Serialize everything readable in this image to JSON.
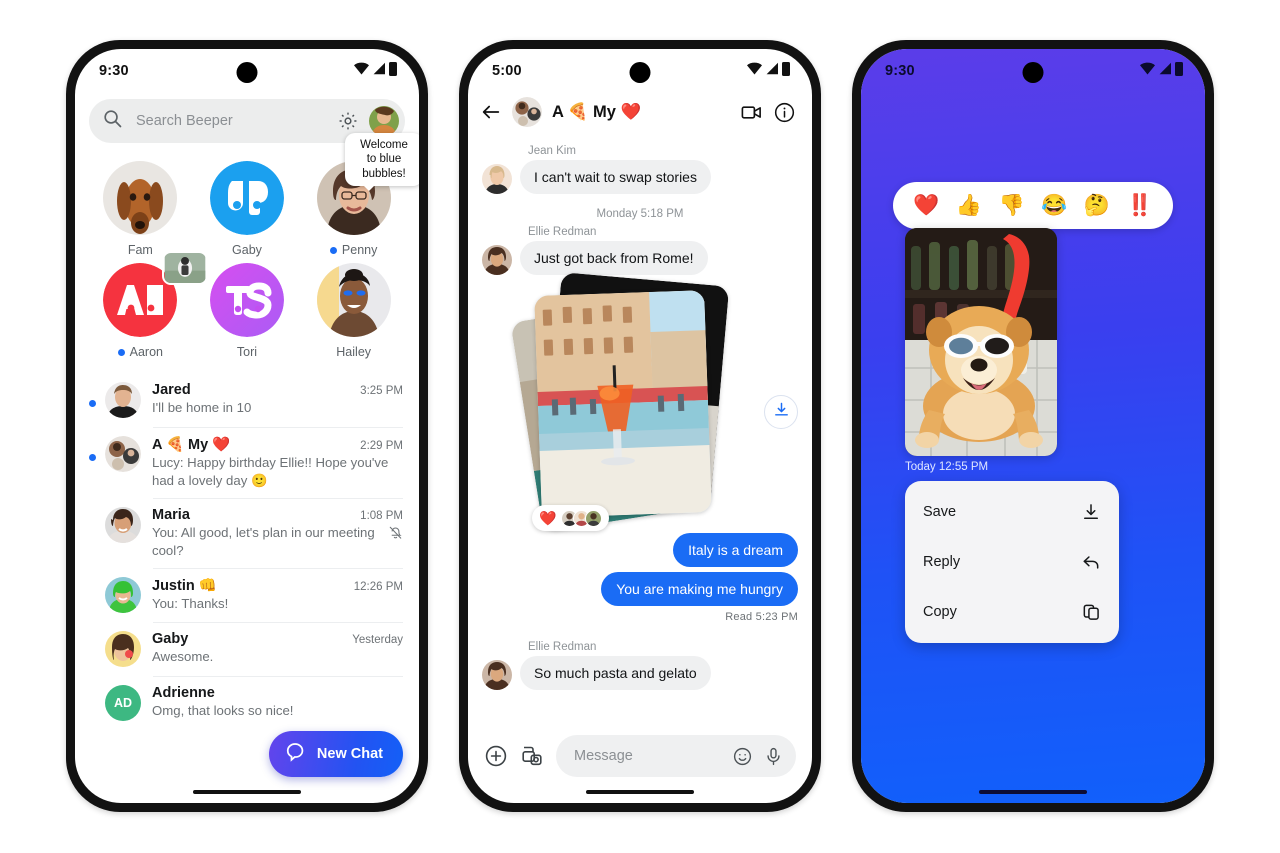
{
  "colors": {
    "accent_blue": "#1a6cf5",
    "bubble_blue": "#1a6cf5",
    "fab_gradient_from": "#6344ec",
    "fab_gradient_to": "#1360f7",
    "p3_bg_from": "#5b3de9",
    "p3_bg_to": "#1160fb",
    "bubble_grey": "#eff0f1"
  },
  "phone1": {
    "status": {
      "time": "9:30",
      "icons": [
        "wifi-icon",
        "signal-icon",
        "battery-icon"
      ]
    },
    "search": {
      "placeholder": "Search Beeper",
      "icon": "search-icon",
      "settings_icon": "gear-icon",
      "avatar": "profile-avatar"
    },
    "pins": [
      {
        "name": "Fam",
        "unread": false,
        "avatar_kind": "photo-dog",
        "tooltip": null,
        "badge": false
      },
      {
        "name": "Gaby",
        "unread": false,
        "avatar_kind": "logo-6b-blue",
        "tooltip": null,
        "badge": false
      },
      {
        "name": "Penny",
        "unread": true,
        "avatar_kind": "photo-woman-glasses",
        "tooltip": "Welcome to blue bubbles!",
        "badge": false
      },
      {
        "name": "Aaron",
        "unread": true,
        "avatar_kind": "logo-an-red",
        "tooltip": null,
        "badge": true
      },
      {
        "name": "Tori",
        "unread": false,
        "avatar_kind": "logo-ts-magenta",
        "tooltip": null,
        "badge": false
      },
      {
        "name": "Hailey",
        "unread": false,
        "avatar_kind": "photo-woman-bluemakeup",
        "tooltip": null,
        "badge": false
      }
    ],
    "chats": [
      {
        "name": "Jared",
        "emoji": "",
        "time": "3:25 PM",
        "preview": "I'll be home in 10",
        "unread": true,
        "muted": false,
        "avatar_kind": "photo-man-black"
      },
      {
        "name": "A 🍕 My ❤️",
        "emoji": "",
        "time": "2:29 PM",
        "preview": "Lucy: Happy birthday Ellie!! Hope you've had a lovely day  🙂",
        "unread": true,
        "muted": false,
        "avatar_kind": "group-collage"
      },
      {
        "name": "Maria",
        "emoji": "",
        "time": "1:08 PM",
        "preview": "You: All good, let's plan in our meeting cool?",
        "unread": false,
        "muted": true,
        "avatar_kind": "photo-woman-smiling"
      },
      {
        "name": "Justin 👊",
        "emoji": "",
        "time": "12:26 PM",
        "preview": "You: Thanks!",
        "unread": false,
        "muted": false,
        "avatar_kind": "photo-green-hoodie"
      },
      {
        "name": "Gaby",
        "emoji": "",
        "time": "Yesterday",
        "preview": "Awesome.",
        "unread": false,
        "muted": false,
        "avatar_kind": "memoji-yellow"
      },
      {
        "name": "Adrienne",
        "emoji": "",
        "time": "",
        "preview": "Omg, that looks so nice!",
        "unread": false,
        "muted": false,
        "avatar_kind": "initials-AD-green",
        "initials": "AD"
      }
    ],
    "fab": {
      "label": "New Chat",
      "icon": "chat-bubble-icon"
    }
  },
  "phone2": {
    "status": {
      "time": "5:00"
    },
    "header": {
      "title": "A 🍕 My ❤️",
      "back_icon": "back-arrow-icon",
      "video_icon": "video-camera-icon",
      "info_icon": "info-icon",
      "avatar": "group-collage"
    },
    "messages": [
      {
        "type": "incoming",
        "sender": "Jean Kim",
        "text": "I can't wait to swap stories",
        "avatar_kind": "photo-blonde-woman"
      },
      {
        "type": "daystamp",
        "text": "Monday 5:18 PM"
      },
      {
        "type": "incoming",
        "sender": "Ellie Redman",
        "text": "Just got back from Rome!",
        "avatar_kind": "photo-curly-woman"
      },
      {
        "type": "photo-stack",
        "reaction": "❤️",
        "download_icon": "download-icon"
      },
      {
        "type": "outgoing",
        "text": "Italy is a dream"
      },
      {
        "type": "outgoing",
        "text": "You are making me hungry"
      },
      {
        "type": "readreceipt",
        "text": "Read  5:23 PM"
      },
      {
        "type": "incoming",
        "sender": "Ellie Redman",
        "text": "So much pasta and gelato",
        "avatar_kind": "photo-curly-woman"
      }
    ],
    "composer": {
      "placeholder": "Message",
      "plus_icon": "plus-circle-icon",
      "gallery_icon": "photo-library-icon",
      "emoji_icon": "emoji-smiley-icon",
      "mic_icon": "microphone-icon"
    }
  },
  "phone3": {
    "status": {
      "time": "9:30"
    },
    "reactions": [
      "❤️",
      "👍",
      "👎",
      "😂",
      "🤔",
      "‼️"
    ],
    "photo": {
      "alt": "chow-chow-dog-with-sunglasses",
      "timestamp": "Today  12:55 PM"
    },
    "menu": [
      {
        "label": "Save",
        "icon": "download-icon"
      },
      {
        "label": "Reply",
        "icon": "reply-arrow-icon"
      },
      {
        "label": "Copy",
        "icon": "copy-icon"
      }
    ]
  }
}
